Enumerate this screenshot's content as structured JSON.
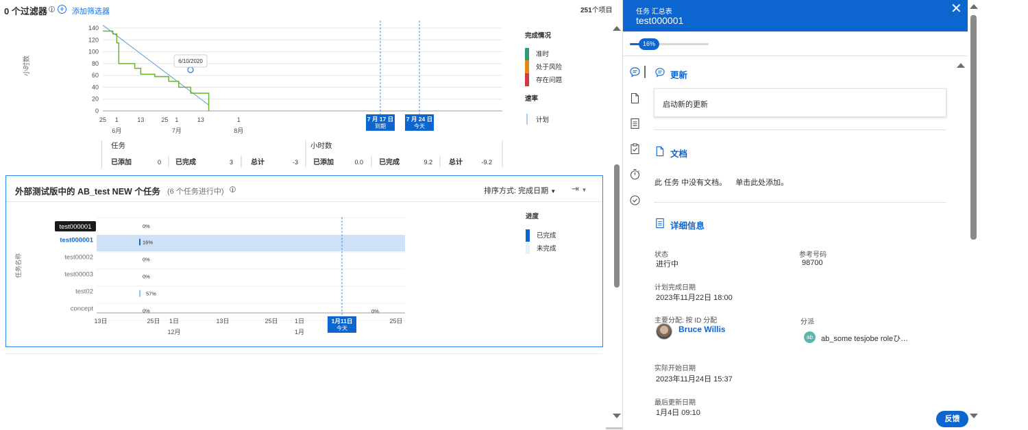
{
  "header": {
    "filters_label": "0 个过滤器",
    "add_filter": "添加筛选器",
    "items_count": "251",
    "items_suffix": "个项目"
  },
  "burndown": {
    "tooltip_date": "6/10/2020",
    "y_axis_label": "小时数",
    "legend": {
      "status_title": "完成情况",
      "on_time": "准时",
      "at_risk": "处于风险",
      "in_trouble": "存在问题",
      "rate_title": "速率",
      "plan": "计划"
    },
    "markers": {
      "due_line1": "7 月 17 日",
      "due_line2": "到期",
      "today_line1": "7 月 24 日",
      "today_line2": "今天"
    },
    "stats": {
      "tasks_header": "任务",
      "hours_header": "小时数",
      "tasks": [
        {
          "label": "已添加",
          "value": "0"
        },
        {
          "label": "已完成",
          "value": "3"
        },
        {
          "label": "总计",
          "value": "-3"
        }
      ],
      "hours": [
        {
          "label": "已添加",
          "value": "0.0"
        },
        {
          "label": "已完成",
          "value": "9.2"
        },
        {
          "label": "总计",
          "value": "-9.2"
        }
      ]
    },
    "colors": {
      "on_time": "#2d9d78",
      "at_risk": "#e68619",
      "in_trouble": "#d7373f",
      "actual_line": "#6bb52e",
      "plan_line": "#5b9bd5"
    }
  },
  "gantt": {
    "title": "外部测试版中的 AB_test NEW 个任务",
    "subtitle": "(6 个任务进行中)",
    "sort_label": "排序方式: 完成日期",
    "y_axis_label": "任务名称",
    "hover_tag": "test000001",
    "legend": {
      "title": "进度",
      "done": "已完成",
      "not_done": "未完成"
    },
    "today_line1": "1月11日",
    "today_line2": "今天"
  },
  "panel": {
    "kind": "任务 汇总表",
    "name": "test000001",
    "progress": "16%",
    "progress_value": 0.16,
    "updates_title": "更新",
    "start_update": "启动新的更新",
    "docs_title": "文档",
    "docs_empty": "此 任务 中没有文档。",
    "docs_add": "单击此处添加。",
    "details_title": "详细信息",
    "fields": {
      "status_label": "状态",
      "status_value": "进行中",
      "ref_label": "参考号码",
      "ref_value": "98700",
      "planned_label": "计划完成日期",
      "planned_value": "2023年11月22日 18:00",
      "primary_label": "主要分配: 按 ID 分配",
      "primary_value": "Bruce Willis",
      "assign_label": "分派",
      "assign_value": "ab_some tesjobe roleひ…",
      "actual_start_label": "实际开始日期",
      "actual_start_value": "2023年11月24日 15:37",
      "last_update_label": "最后更新日期",
      "last_update_value": "1月4日 09:10"
    },
    "feedback": "反馈"
  },
  "chart_data": [
    {
      "type": "line",
      "title": "",
      "ylabel": "小时数",
      "x_tick_labels": [
        "25",
        "1",
        "13",
        "25",
        "1",
        "13",
        "1"
      ],
      "month_labels": [
        "6月",
        "7月",
        "8月"
      ],
      "ylim": [
        0,
        140
      ],
      "yticks": [
        0,
        20,
        40,
        60,
        80,
        100,
        120,
        140
      ],
      "series": [
        {
          "name": "计划",
          "x": [
            "2020-05-25",
            "2020-07-17"
          ],
          "values": [
            145,
            10
          ]
        },
        {
          "x": [
            "2020-05-25",
            "2020-05-30",
            "2020-06-01",
            "2020-06-02",
            "2020-06-10",
            "2020-06-13",
            "2020-06-20",
            "2020-06-27",
            "2020-07-02",
            "2020-07-08",
            "2020-07-17",
            "2020-07-17"
          ],
          "values": [
            135,
            130,
            115,
            80,
            72,
            62,
            58,
            50,
            40,
            30,
            12,
            0
          ]
        }
      ]
    },
    {
      "type": "bar",
      "title": "外部测试版中的 AB_test NEW 个任务",
      "ylabel": "任务名称",
      "categories": [
        "test000001",
        "test00002",
        "test00003",
        "test02",
        "concept"
      ],
      "values": [
        16,
        0,
        0,
        57,
        0
      ],
      "extra_label": "0%",
      "x_tick_labels": [
        "13日",
        "25日",
        "1日",
        "13日",
        "25日",
        "1日",
        "13日",
        "25日"
      ],
      "month_labels": [
        "12月",
        "1月"
      ]
    }
  ]
}
